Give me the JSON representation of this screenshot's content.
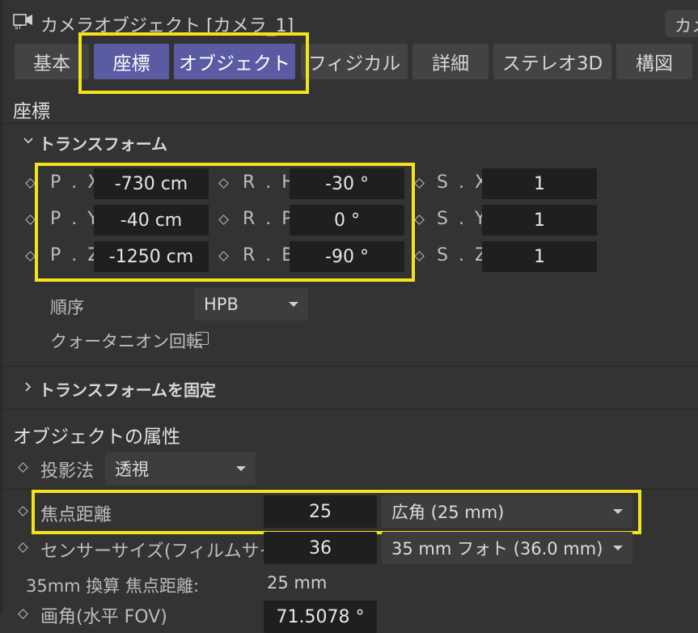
{
  "header": {
    "title": "カメラオブジェクト [カメラ_1]",
    "right_button": "カメ",
    "icon": "camera-object-icon"
  },
  "tabs": [
    {
      "label": "基本",
      "active": false
    },
    {
      "label": "座標",
      "active": true
    },
    {
      "label": "オブジェクト",
      "active": true
    },
    {
      "label": "フィジカル",
      "active": false
    },
    {
      "label": "詳細",
      "active": false
    },
    {
      "label": "ステレオ3D",
      "active": false
    },
    {
      "label": "構図",
      "active": false
    }
  ],
  "coords": {
    "section_title": "座標",
    "transform_label": "トランスフォーム",
    "pos": [
      {
        "label": "P . X",
        "value": "-730 cm"
      },
      {
        "label": "P . Y",
        "value": "-40 cm"
      },
      {
        "label": "P . Z",
        "value": "-1250 cm"
      }
    ],
    "rot": [
      {
        "label": "R . H",
        "value": "-30 °"
      },
      {
        "label": "R . P",
        "value": "0 °"
      },
      {
        "label": "R . B",
        "value": "-90 °"
      }
    ],
    "scale": [
      {
        "label": "S . X",
        "value": "1"
      },
      {
        "label": "S . Y",
        "value": "1"
      },
      {
        "label": "S . Z",
        "value": "1"
      }
    ],
    "order_label": "順序",
    "order_value": "HPB",
    "quaternion_label": "クォータニオン回転",
    "freeze_label": "トランスフォームを固定"
  },
  "object": {
    "section_title": "オブジェクトの属性",
    "projection_label": "投影法",
    "projection_value": "透視",
    "focal_label": "焦点距離",
    "focal_value": "25",
    "focal_preset": "広角 (25 mm)",
    "sensor_label": "センサーサイズ(フィルムサイズ)",
    "sensor_value": "36",
    "sensor_preset": "35 mm フォト (36.0 mm)",
    "equiv_label": "35mm 換算 焦点距離:",
    "equiv_value": "25 mm",
    "fov_label": "画角(水平 FOV)",
    "fov_value": "71.5078 °"
  },
  "colors": {
    "highlight": "#f4e31c",
    "tab_active": "#5a5ba3",
    "background": "#333333"
  }
}
